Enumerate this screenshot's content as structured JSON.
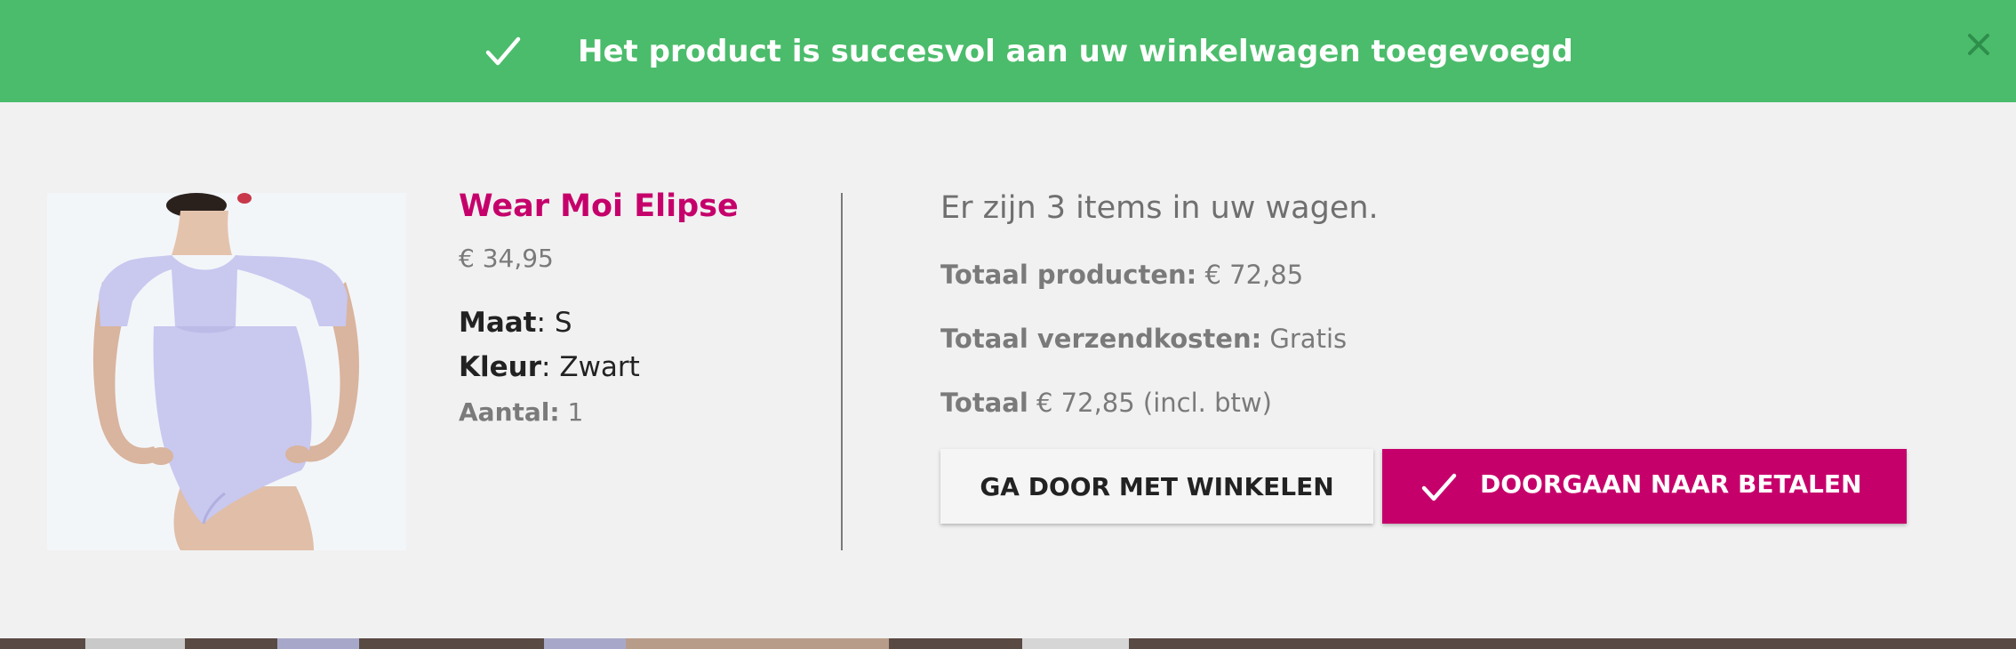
{
  "notification": {
    "message": "Het product is succesvol aan uw winkelwagen toegevoegd",
    "background_color": "#4bbc6b",
    "icons": {
      "status": "check-icon",
      "close": "close-icon"
    }
  },
  "product": {
    "name": "Wear Moi Elipse",
    "price": "€ 34,95",
    "size_label": "Maat",
    "size_value": ": S",
    "color_label": "Kleur",
    "color_value": ": Zwart",
    "quantity_label": "Aantal:",
    "quantity_value": " 1",
    "name_color": "#c6006b"
  },
  "cart": {
    "count_text": "Er zijn 3 items in uw wagen.",
    "total_products_label": "Totaal producten:",
    "total_products_value": " € 72,85",
    "total_shipping_label": "Totaal verzendkosten:",
    "total_shipping_value": " Gratis",
    "total_label": "Totaal",
    "total_value": " € 72,85 (incl. btw)"
  },
  "actions": {
    "continue_label": "GA DOOR MET WINKELEN",
    "checkout_label": "DOORGAAN NAAR BETALEN",
    "checkout_color": "#c6006b"
  }
}
